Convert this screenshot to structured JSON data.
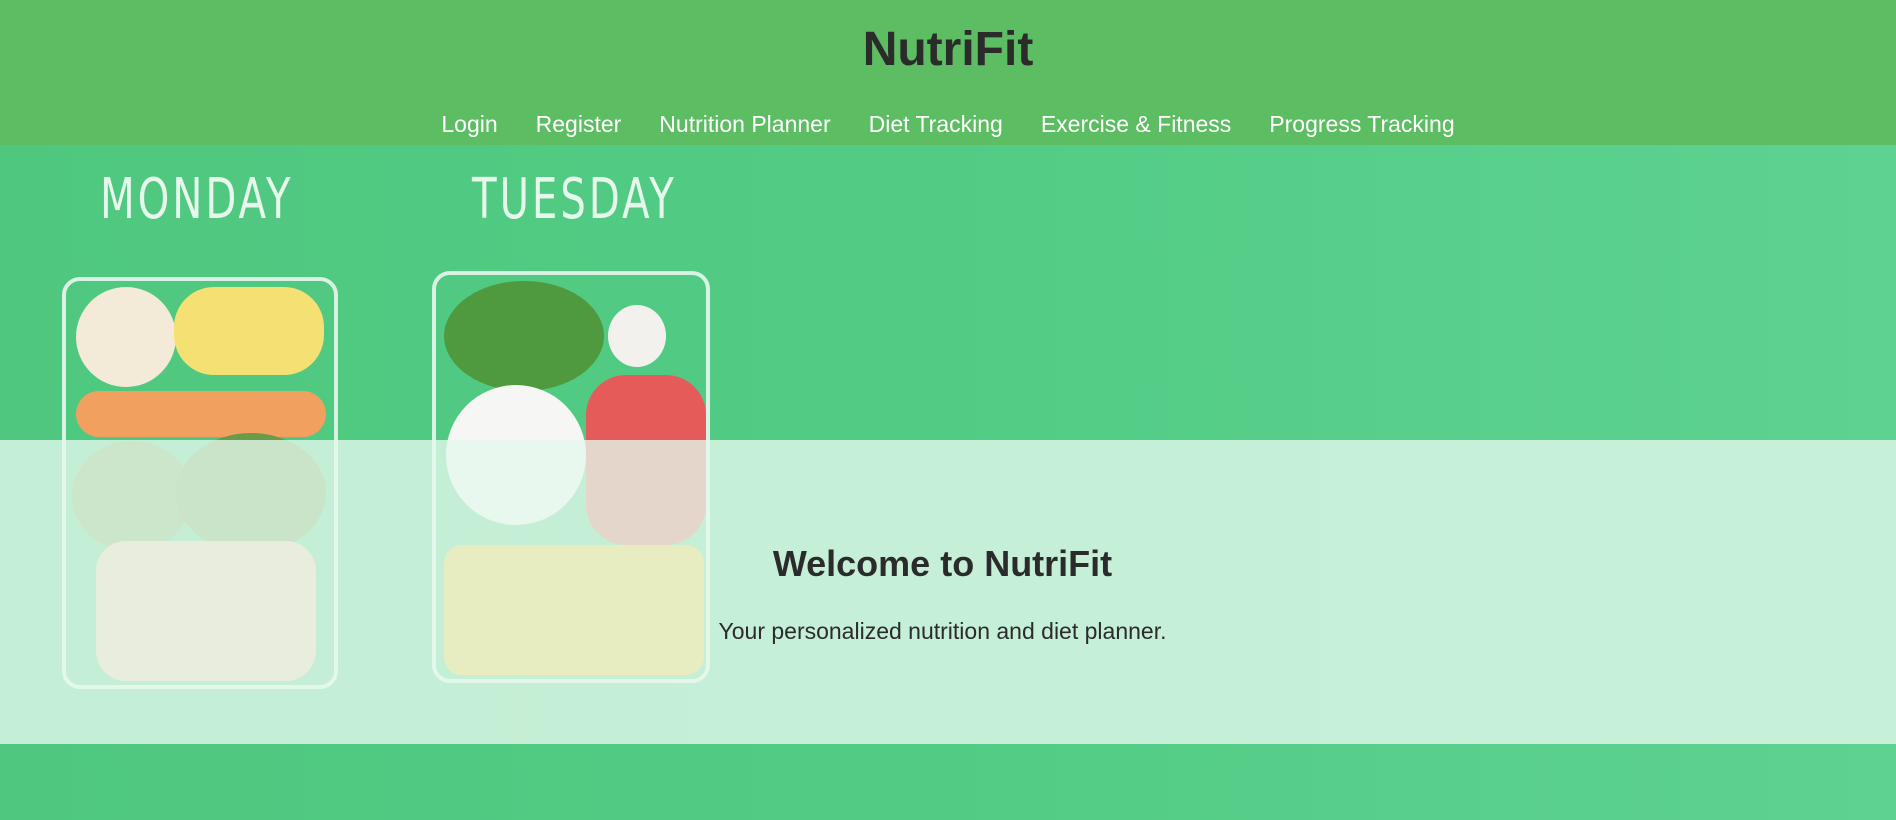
{
  "header": {
    "title": "NutriFit",
    "nav": [
      {
        "label": "Login"
      },
      {
        "label": "Register"
      },
      {
        "label": "Nutrition Planner"
      },
      {
        "label": "Diet Tracking"
      },
      {
        "label": "Exercise & Fitness"
      },
      {
        "label": "Progress Tracking"
      }
    ]
  },
  "hero": {
    "image_labels": [
      "MONDAY",
      "TUESDAY"
    ],
    "heading": "Welcome to NutriFit",
    "subtext": "Your personalized nutrition and diet planner."
  },
  "colors": {
    "header_bg": "#5dbd63",
    "hero_bg": "#52cc85",
    "text_dark": "#2b2b2b",
    "nav_text": "#ffffff"
  }
}
